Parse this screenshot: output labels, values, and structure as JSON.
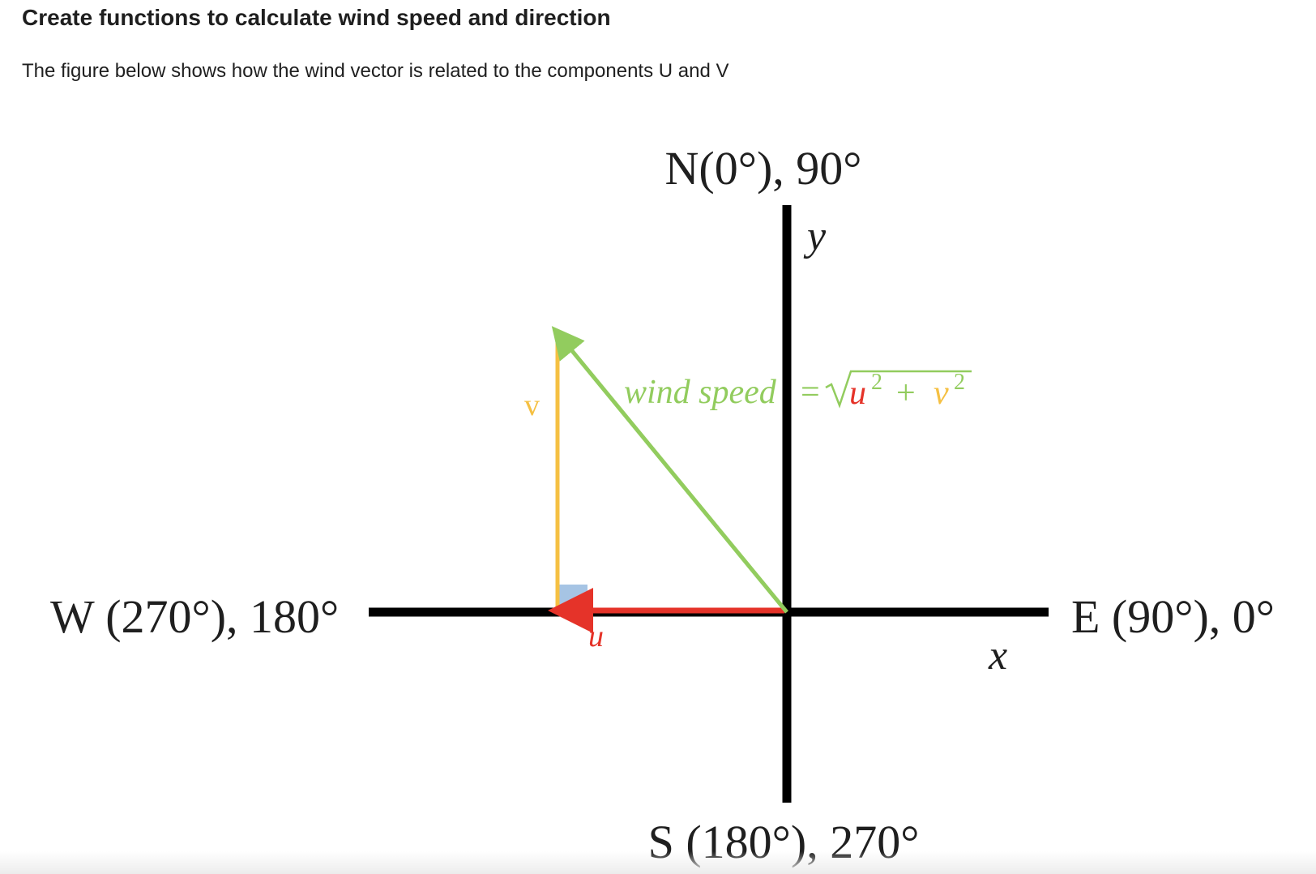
{
  "page": {
    "heading": "Create functions to calculate wind speed and direction",
    "intro": "The figure below shows how the wind vector is related to the components U and V"
  },
  "diagram": {
    "labels": {
      "north": "N(0°), 90°",
      "south": "S (180°), 270°",
      "east": "E (90°), 0°",
      "west": "W (270°), 180°",
      "y_axis": "y",
      "x_axis": "x",
      "v_component": "v",
      "u_component": "u"
    },
    "formula": {
      "lhs": "wind speed",
      "equals": "=",
      "u_var": "u",
      "plus": " + ",
      "v_var": "v",
      "exponent": "2"
    },
    "colors": {
      "axes": "#000000",
      "u_vector": "#e53329",
      "v_vector": "#f5c043",
      "wind_vector": "#92cc5e",
      "right_angle": "#a6c4e4",
      "text": "#1f1f1f"
    }
  }
}
